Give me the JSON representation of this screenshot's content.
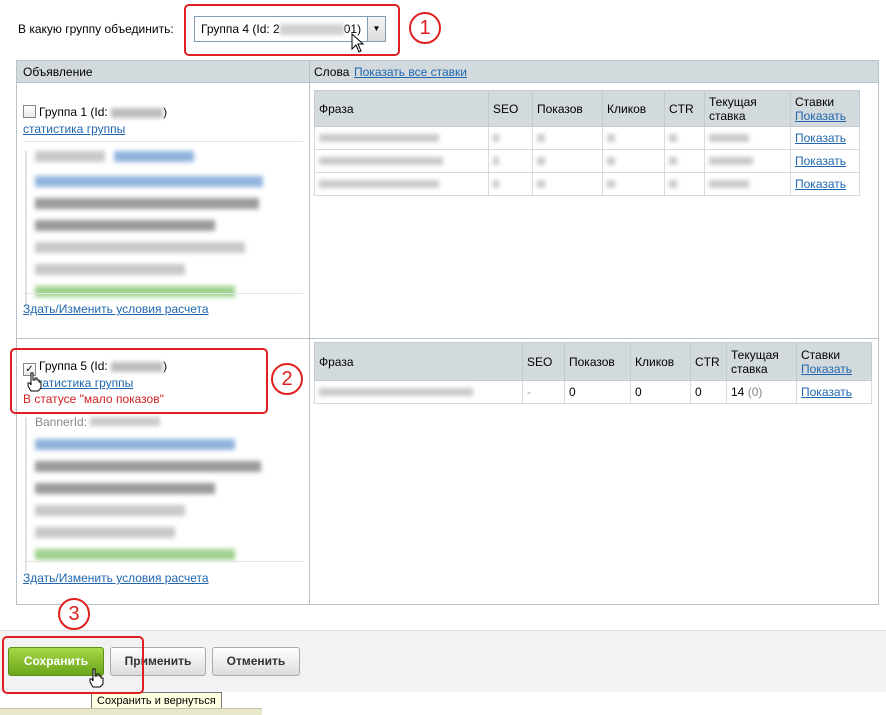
{
  "merge": {
    "label": "В какую группу объединить:",
    "selected_prefix": "Группа 4 (Id: 2",
    "selected_suffix": "01)"
  },
  "table_headers": {
    "ad": "Объявление",
    "words": "Слова",
    "show_all_bids": "Показать все ставки"
  },
  "group1": {
    "label": "Группа 1 (Id:",
    "label_end": ")",
    "stats_link": "статистика группы",
    "conditions_link": "Здать/Изменить условия расчета"
  },
  "group5": {
    "label": "Группа 5 (Id:",
    "label_end": ")",
    "stats_link": "статистика группы",
    "status": "В статусе \"мало показов\"",
    "banner_label": "BannerId:",
    "conditions_link": "Здать/Изменить условия расчета"
  },
  "phrase_columns": {
    "phrase": "Фраза",
    "seo": "SEO",
    "shows": "Показов",
    "clicks": "Кликов",
    "ctr": "CTR",
    "current_bid_1": "Текущая",
    "current_bid_2": "ставка",
    "bids": "Ставки",
    "show": "Показать"
  },
  "group5_row": {
    "seo": "-",
    "shows": "0",
    "clicks": "0",
    "ctr": "0",
    "bid": "14",
    "bid_extra": "(0)",
    "action": "Показать"
  },
  "group1_rows_action": [
    "Показать",
    "Показать",
    "Показать"
  ],
  "buttons": {
    "save": "Сохранить",
    "apply": "Применить",
    "cancel": "Отменить"
  },
  "tooltip": "Сохранить и вернуться",
  "annotations": [
    "1",
    "2",
    "3"
  ],
  "colors": {
    "annotation": "#e02020",
    "link": "#2067b0",
    "save_button": "#7cb82f",
    "status_red": "#d11f1f"
  }
}
